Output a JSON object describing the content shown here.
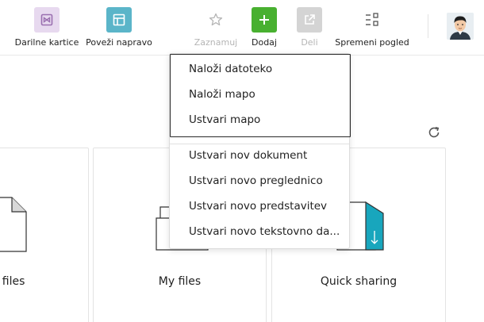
{
  "toolbar": {
    "items": [
      {
        "label": "Darilne kartice",
        "icon": "gift-card-icon",
        "color": "#e7d9ef"
      },
      {
        "label": "Poveži napravo",
        "icon": "device-link-icon",
        "color": "#5bb5c9"
      },
      {
        "label": "Zaznamuj",
        "icon": "star-icon",
        "disabled": true
      },
      {
        "label": "Dodaj",
        "icon": "plus-icon",
        "color": "#48b030"
      },
      {
        "label": "Deli",
        "icon": "share-icon",
        "disabled": true
      },
      {
        "label": "Spremeni pogled",
        "icon": "view-toggle-icon"
      }
    ]
  },
  "add_menu": {
    "upload_group": [
      "Naloži datoteko",
      "Naloži mapo",
      "Ustvari mapo"
    ],
    "create_group": [
      "Ustvari nov dokument",
      "Ustvari novo preglednico",
      "Ustvari novo predstavitev",
      "Ustvari novo tekstovno da..."
    ]
  },
  "cards": [
    {
      "label": "s files"
    },
    {
      "label": "My files"
    },
    {
      "label": "Quick sharing"
    }
  ],
  "colors": {
    "accent_green": "#48b030",
    "accent_teal": "#5bb5c9",
    "card_border": "#e3e3e3"
  }
}
